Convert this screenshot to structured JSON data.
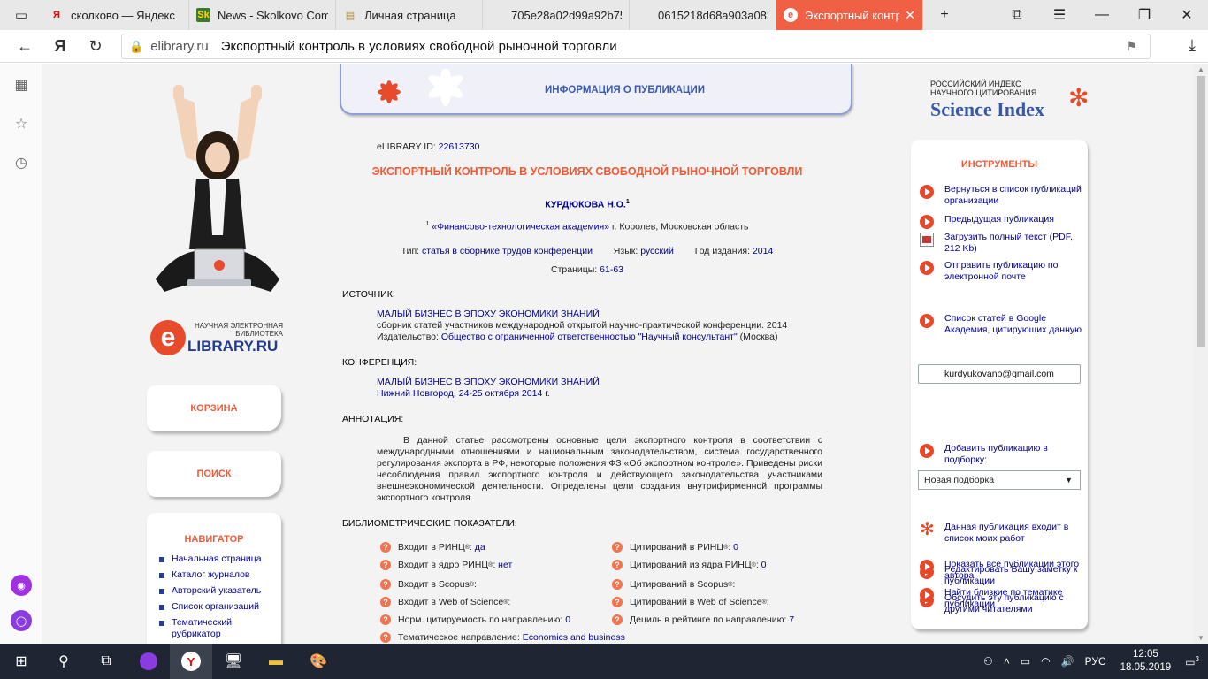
{
  "browser": {
    "tabs": [
      {
        "label": "сколково — Яндекс",
        "icon": "yandex-icon"
      },
      {
        "label": "News - Skolkovo Com",
        "icon": "skolkovo-icon"
      },
      {
        "label": "Личная страница",
        "icon": "page-icon"
      },
      {
        "label": "705e28a02d99a92b75",
        "icon": "blank-icon"
      },
      {
        "label": "0615218d68a903a082",
        "icon": "blank-icon"
      },
      {
        "label": "Экспортный контр",
        "icon": "elibrary-icon",
        "active": true
      }
    ],
    "address": {
      "domain": "elibrary.ru",
      "page_title": "Экспортный контроль в условиях свободной рыночной торговли"
    }
  },
  "left": {
    "logo_caption": "НАУЧНАЯ ЭЛЕКТРОННАЯ БИБЛИОТЕКА",
    "logo_text": "LIBRARY.RU",
    "basket": "КОРЗИНА",
    "search": "ПОИСК",
    "navigator_title": "НАВИГАТОР",
    "nav_items": [
      "Начальная страница",
      "Каталог журналов",
      "Авторский указатель",
      "Список организаций",
      "Тематический рубрикатор"
    ]
  },
  "header": {
    "title": "ИНФОРМАЦИЯ О ПУБЛИКАЦИИ"
  },
  "pub": {
    "id_label": "eLIBRARY ID:",
    "id_value": "22613730",
    "title": "ЭКСПОРТНЫЙ КОНТРОЛЬ В УСЛОВИЯХ СВОБОДНОЙ РЫНОЧНОЙ ТОРГОВЛИ",
    "author": "КУРДЮКОВА Н.О.",
    "author_sup": "1",
    "aff_sup": "1",
    "affiliation_link": "«Финансово-технологическая академия»",
    "affiliation_place": "г. Королев, Московская область",
    "type_label": "Тип:",
    "type_value": "статья в сборнике трудов конференции",
    "lang_label": "Язык:",
    "lang_value": "русский",
    "year_label": "Год издания:",
    "year_value": "2014",
    "pages_label": "Страницы:",
    "pages_value": "61-63",
    "source_label": "ИСТОЧНИК:",
    "source_title": "МАЛЫЙ БИЗНЕС В ЭПОХУ ЭКОНОМИКИ ЗНАНИЙ",
    "source_desc": "сборник статей участников международной открытой научно-практической конференции. 2014",
    "publisher_label": "Издательство:",
    "publisher_value": "Общество с ограниченной ответственностью \"Научный консультант\"",
    "publisher_city": "(Москва)",
    "conf_label": "КОНФЕРЕНЦИЯ:",
    "conf_title": "МАЛЫЙ БИЗНЕС В ЭПОХУ ЭКОНОМИКИ ЗНАНИЙ",
    "conf_place": "Нижний Новгород, 24-25 октября 2014 г.",
    "abstract_label": "АННОТАЦИЯ:",
    "abstract": "В данной статье рассмотрены основные цели экспортного контроля в соответствии с международными отношениями и национальным законодательством, система государственного регулирования экспорта в РФ, некоторые положения ФЗ «Об экспортном контроле». Приведены риски несоблюдения правил экспортного контроля и действующего законодательства участниками внешнеэкономической деятельности. Определены цели создания внутрифирменной программы экспортного контроля.",
    "biblio_label": "БИБЛИОМЕТРИЧЕСКИЕ ПОКАЗАТЕЛИ:"
  },
  "biblio_left": [
    {
      "label": "Входит в РИНЦ",
      "sup": "®",
      "sep": ":",
      "value": "да"
    },
    {
      "label": "Входит в ядро РИНЦ",
      "sup": "®",
      "sep": ":",
      "value": "нет"
    },
    {
      "label": "Входит в Scopus",
      "sup": "®",
      "sep": ":",
      "value": ""
    },
    {
      "label": "Входит в Web of Science",
      "sup": "®",
      "sep": ":",
      "value": ""
    },
    {
      "label": "Норм. цитируемость по направлению",
      "sup": "",
      "sep": ":",
      "value": "0"
    },
    {
      "label": "Тематическое направление",
      "sup": "",
      "sep": ":",
      "value": "Economics and business"
    }
  ],
  "biblio_right": [
    {
      "label": "Цитирований в РИНЦ",
      "sup": "®",
      "sep": ":",
      "value": "0"
    },
    {
      "label": "Цитирований из ядра РИНЦ",
      "sup": "®",
      "sep": ":",
      "value": "0"
    },
    {
      "label": "Цитирований в Scopus",
      "sup": "®",
      "sep": ":",
      "value": ""
    },
    {
      "label": "Цитирований в Web of Science",
      "sup": "®",
      "sep": ":",
      "value": ""
    },
    {
      "label": "Дециль в рейтинге по направлению",
      "sup": "",
      "sep": ":",
      "value": "7"
    }
  ],
  "right": {
    "si_line1": "РОССИЙСКИЙ ИНДЕКС",
    "si_line2": "НАУЧНОГО ЦИТИРОВАНИЯ",
    "si_brand": "Science Index",
    "tools_title": "ИНСТРУМЕНТЫ",
    "tools": [
      "Вернуться в список публикаций организации",
      "Предыдущая публикация",
      "Загрузить полный текст (PDF, 212 Kb)",
      "Отправить публикацию по электронной почте",
      "Список статей в Google Академия, цитирующих данную",
      "Добавить публикацию в подборку:",
      "Данная публикация входит в список моих работ",
      "Редактировать Вашу заметку к публикации",
      "Обсудить эту публикацию с другими читателями",
      "Показать все публикации этого автора",
      "Найти близкие по тематике публикации"
    ],
    "email_value": "kurdyukovano@gmail.com",
    "select_value": "Новая подборка"
  },
  "taskbar": {
    "lang": "РУС",
    "time": "12:05",
    "date": "18.05.2019",
    "notif": "3"
  }
}
